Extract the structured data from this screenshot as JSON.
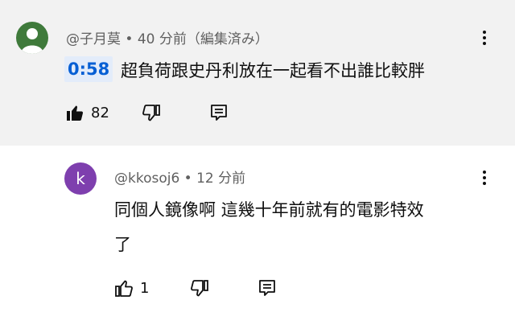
{
  "comment": {
    "meta": "@子月莫 • 40 分前（編集済み）",
    "timestamp": "0:58",
    "text": "超負荷跟史丹利放在一起看不出誰比較胖",
    "likes": "82"
  },
  "reply": {
    "avatar_letter": "k",
    "meta": "@kkosoj6 • 12 分前",
    "text_line1": "同個人鏡像啊 這幾十年前就有的電影特效",
    "text_line2": "了",
    "likes": "1"
  },
  "colors": {
    "highlight_bg": "#f2f2f2",
    "link_blue": "#065fd4",
    "avatar1": "#3f7a3b",
    "avatar2": "#7e3fae"
  }
}
